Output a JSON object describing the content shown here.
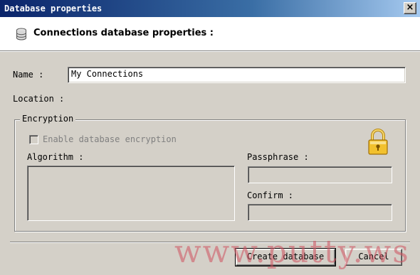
{
  "window": {
    "title": "Database properties",
    "close_glyph": "×"
  },
  "header": {
    "icon": "database-icon",
    "title": "Connections database properties :"
  },
  "form": {
    "name_label": "Name :",
    "name_value": "My Connections",
    "location_label": "Location :"
  },
  "encryption": {
    "group_label": "Encryption",
    "checkbox_label": "Enable database encryption",
    "checkbox_checked": false,
    "algorithm_label": "Algorithm :",
    "passphrase_label": "Passphrase :",
    "confirm_label": "Confirm :",
    "lock_icon": "lock-icon"
  },
  "buttons": {
    "create_label": "Create database",
    "cancel_label": "Cancel"
  },
  "watermark": {
    "text": "www.putty.ws"
  },
  "colors": {
    "titlebar_start": "#0a246a",
    "titlebar_end": "#a6caf0",
    "dialog_bg": "#d4d0c8",
    "watermark": "#cd505f"
  }
}
